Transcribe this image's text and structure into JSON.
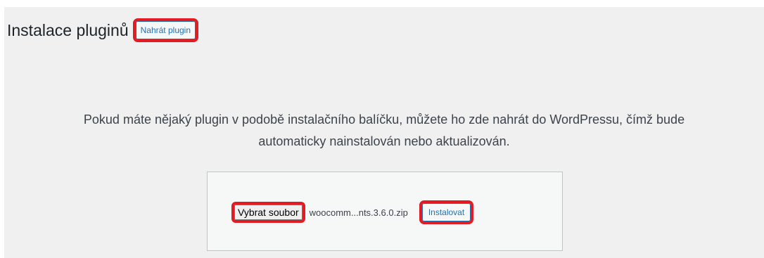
{
  "header": {
    "title": "Instalace pluginů",
    "upload_label": "Nahrát plugin"
  },
  "description": {
    "line1": "Pokud máte nějaký plugin v podobě instalačního balíčku, můžete ho zde nahrát do WordPressu, čímž bude",
    "line2": "automaticky nainstalován nebo aktualizován."
  },
  "upload_form": {
    "choose_file_label": "Vybrat soubor",
    "file_name": "woocomm...nts.3.6.0.zip",
    "install_label": "Instalovat"
  },
  "colors": {
    "background": "#f0f0f1",
    "highlight": "#e31b23",
    "link": "#2271b1"
  }
}
